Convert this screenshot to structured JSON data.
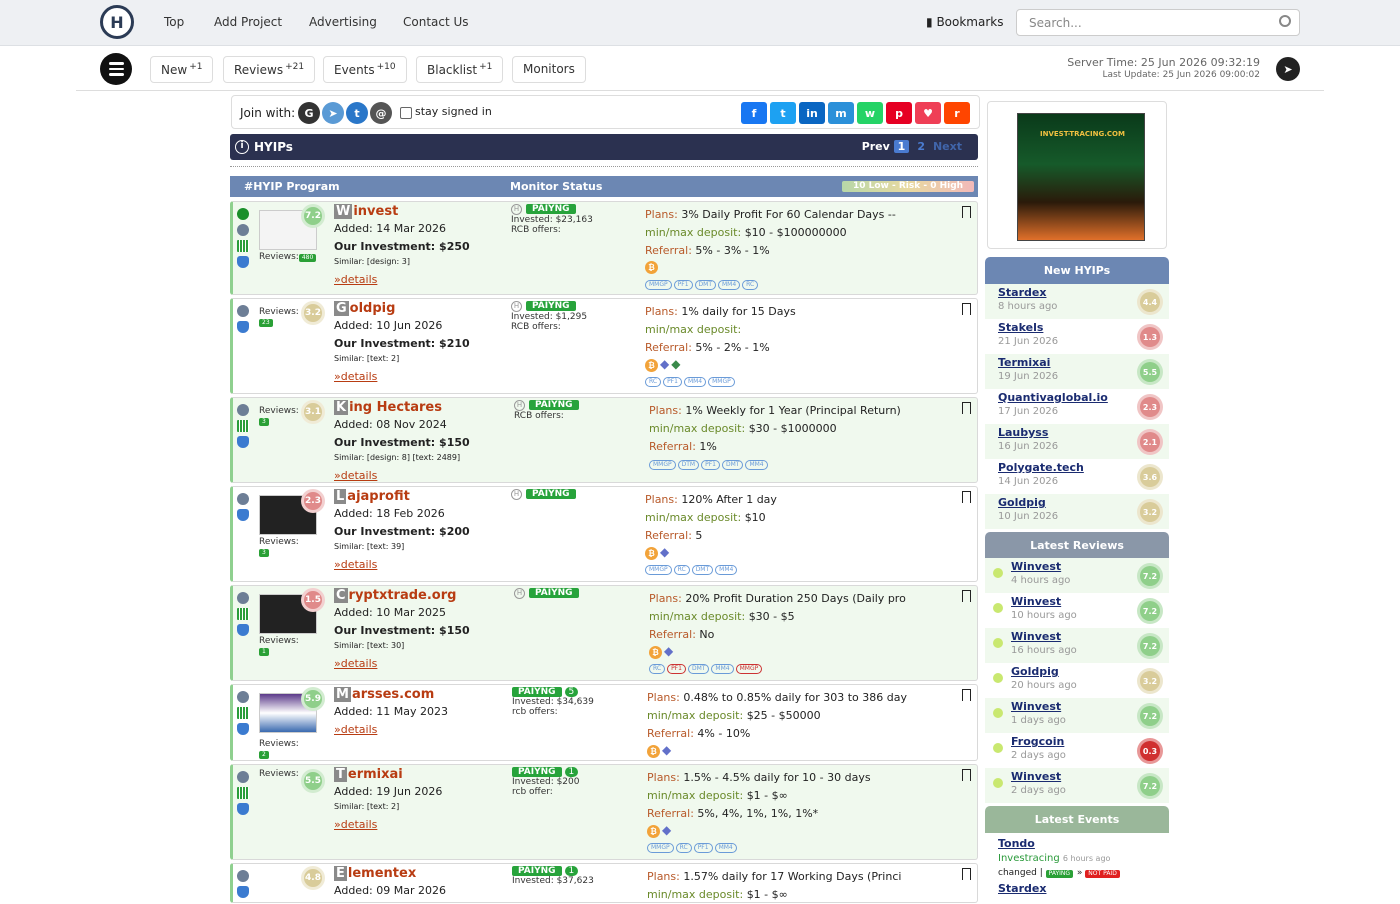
{
  "nav": {
    "links": [
      "Top",
      "Add Project",
      "Advertising",
      "Contact Us"
    ],
    "bookmarks": "Bookmarks",
    "search_placeholder": "Search..."
  },
  "bar2": {
    "pills": [
      {
        "label": "New",
        "sup": "+1"
      },
      {
        "label": "Reviews",
        "sup": "+21"
      },
      {
        "label": "Events",
        "sup": "+10"
      },
      {
        "label": "Blacklist",
        "sup": "+1"
      },
      {
        "label": "Monitors",
        "sup": ""
      }
    ],
    "server_time": "Server Time: 25 Jun 2026 09:32:19",
    "last_update": "Last Update: 25 Jun 2026 09:00:02"
  },
  "join": {
    "label": "Join with:",
    "stay": "stay signed in"
  },
  "hyips": {
    "title": "HYIPs",
    "prev": "Prev",
    "page1": "1",
    "page2": "2",
    "next": "Next",
    "col_program": "#HYIP Program",
    "col_status": "Monitor Status",
    "risk": "10 Low - Risk - 0 High"
  },
  "rows": [
    {
      "first": "W",
      "rest": "invest",
      "added": "Added: 14 Mar 2026",
      "inv": "Our Investment: $250",
      "similar": "Similar: [design: 3]",
      "details": "»details",
      "score": "7.2",
      "reviews": "Reviews:",
      "badge": "480",
      "status": "PAIYNG",
      "num": "",
      "invested": "Invested: $23,163",
      "rcb": "RCB offers:",
      "plans": "3% Daily Profit For 60 Calendar Days --",
      "minmax": "$10 - $100000000",
      "referral": "5% - 3% - 1%",
      "tags": [
        "MMGP",
        "PF1",
        "DMT",
        "MM4",
        "RC"
      ]
    },
    {
      "first": "G",
      "rest": "oldpig",
      "added": "Added: 10 Jun 2026",
      "inv": "Our Investment: $210",
      "similar": "Similar: [text: 2]",
      "details": "»details",
      "score": "3.2",
      "reviews": "Reviews:",
      "badge": "23",
      "status": "PAIYNG",
      "num": "",
      "invested": "Invested: $1,295",
      "rcb": "RCB offers:",
      "plans": "1% daily for 15 Days",
      "minmax": "",
      "referral": "5% - 2% - 1%",
      "tags": [
        "RC",
        "PF1",
        "MM4",
        "MMGP"
      ]
    },
    {
      "first": "K",
      "rest": "ing Hectares",
      "added": "Added: 08 Nov 2024",
      "inv": "Our Investment: $150",
      "similar": "Similar: [design: 8] [text: 2489]",
      "details": "»details",
      "score": "3.1",
      "reviews": "Reviews:",
      "badge": "3",
      "status": "PAIYNG",
      "num": "",
      "invested": "",
      "rcb": "RCB offers:",
      "plans": "1% Weekly for 1 Year (Principal Return)",
      "minmax": "$30 - $1000000",
      "referral": "1%",
      "tags": [
        "MMGP",
        "DTM",
        "PF1",
        "DMT",
        "MM4"
      ]
    },
    {
      "first": "L",
      "rest": "ajaprofit",
      "added": "Added: 18 Feb 2026",
      "inv": "Our Investment: $200",
      "similar": "Similar: [text: 39]",
      "details": "»details",
      "score": "2.3",
      "reviews": "Reviews:",
      "badge": "3",
      "status": "PAIYNG",
      "num": "",
      "invested": "",
      "rcb": "",
      "plans": "120% After 1 day",
      "minmax": "$10",
      "referral": "5",
      "tags": [
        "MMGP",
        "RC",
        "DMT",
        "MM4"
      ]
    },
    {
      "first": "C",
      "rest": "ryptxtrade.org",
      "added": "Added: 10 Mar 2025",
      "inv": "Our Investment: $150",
      "similar": "Similar: [text: 30]",
      "details": "»details",
      "score": "1.5",
      "reviews": "Reviews:",
      "badge": "1",
      "status": "PAIYNG",
      "num": "",
      "invested": "",
      "rcb": "",
      "plans": "20% Profit Duration 250 Days (Daily pro",
      "minmax": "$30 - $5",
      "referral": "No",
      "tags": [
        "RC",
        "PF1",
        "DMT",
        "MM4",
        "MMGP"
      ]
    },
    {
      "first": "M",
      "rest": "arsses.com",
      "added": "Added: 11 May 2023",
      "inv": "",
      "similar": "",
      "details": "»details",
      "score": "5.9",
      "reviews": "Reviews:",
      "badge": "2",
      "status": "PAIYNG",
      "num": "5",
      "invested": "Invested: $34,639",
      "rcb": "rcb offers:",
      "plans": "0.48% to 0.85% daily for 303 to 386 day",
      "minmax": "$25 - $50000",
      "referral": "4% - 10%",
      "tags": []
    },
    {
      "first": "T",
      "rest": "ermixai",
      "added": "Added: 19 Jun 2026",
      "inv": "",
      "similar": "Similar: [text: 2]",
      "details": "»details",
      "score": "5.5",
      "reviews": "Reviews:",
      "badge": "",
      "status": "PAIYNG",
      "num": "1",
      "invested": "Invested: $200",
      "rcb": "rcb offer:",
      "plans": "1.5% - 4.5% daily for 10 - 30 days",
      "minmax": "$1 - $∞",
      "referral": "5%, 4%, 1%, 1%, 1%*",
      "tags": [
        "MMGP",
        "RC",
        "PF1",
        "MM4"
      ]
    },
    {
      "first": "E",
      "rest": "lementex",
      "added": "Added: 09 Mar 2026",
      "inv": "",
      "similar": "",
      "details": "",
      "score": "4.8",
      "reviews": "",
      "badge": "",
      "status": "PAIYNG",
      "num": "1",
      "invested": "Invested: $37,623",
      "rcb": "",
      "plans": "1.57% daily for 17 Working Days (Princi",
      "minmax": "$1 - $∞",
      "referral": "",
      "tags": []
    }
  ],
  "labels": {
    "plans": "Plans:",
    "minmax": "min/max deposit:",
    "referral": "Referral:"
  },
  "sidebar": {
    "new_title": "New HYIPs",
    "new": [
      {
        "n": "Stardex",
        "d": "8 hours ago",
        "s": "4.4"
      },
      {
        "n": "Stakels",
        "d": "21 Jun 2026",
        "s": "1.3"
      },
      {
        "n": "Termixai",
        "d": "19 Jun 2026",
        "s": "5.5"
      },
      {
        "n": "Quantivaglobal.io",
        "d": "17 Jun 2026",
        "s": "2.3"
      },
      {
        "n": "Laubyss",
        "d": "16 Jun 2026",
        "s": "2.1"
      },
      {
        "n": "Polygate.tech",
        "d": "14 Jun 2026",
        "s": "3.6"
      },
      {
        "n": "Goldpig",
        "d": "10 Jun 2026",
        "s": "3.2"
      }
    ],
    "rev_title": "Latest Reviews",
    "reviews": [
      {
        "n": "Winvest",
        "d": "4 hours ago",
        "s": "7.2"
      },
      {
        "n": "Winvest",
        "d": "10 hours ago",
        "s": "7.2"
      },
      {
        "n": "Winvest",
        "d": "16 hours ago",
        "s": "7.2"
      },
      {
        "n": "Goldpig",
        "d": "20 hours ago",
        "s": "3.2"
      },
      {
        "n": "Winvest",
        "d": "1 days ago",
        "s": "7.2"
      },
      {
        "n": "Frogcoin",
        "d": "2 days ago",
        "s": "0.3"
      },
      {
        "n": "Winvest",
        "d": "2 days ago",
        "s": "7.2"
      }
    ],
    "ev_title": "Latest Events",
    "ev1_name": "Tondo",
    "ev1_src": "Investracing",
    "ev1_time": "6 hours ago",
    "ev1_changed": "changed |",
    "ev1_from": "PAYING",
    "ev1_to": "NOT PAID",
    "ev2_name": "Stardex"
  }
}
